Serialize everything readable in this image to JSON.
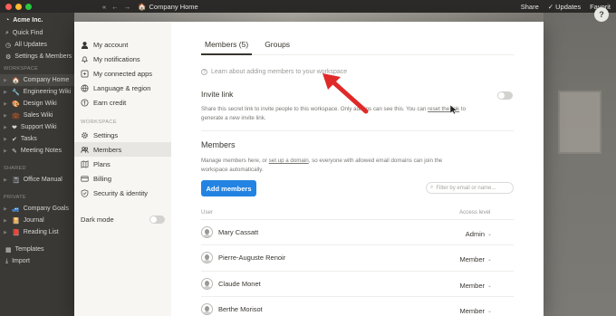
{
  "colors": {
    "accent": "#2383e2",
    "annotation": "#e02a2a"
  },
  "topbar": {
    "breadcrumb": "Company Home",
    "share": "Share",
    "updates": "Updates",
    "favorites": "Favorit",
    "help_label": "?"
  },
  "bg_sidebar": {
    "workspace": "Acme Inc.",
    "quick_find": "Quick Find",
    "all_updates": "All Updates",
    "settings_members": "Settings & Members",
    "section_workspace": "WORKSPACE",
    "pages": [
      "Company Home",
      "Engineering Wiki",
      "Design Wiki",
      "Sales Wiki",
      "Support Wiki",
      "Tasks",
      "Meeting Notes"
    ],
    "section_shared": "SHARED",
    "shared": [
      "Office Manual"
    ],
    "section_private": "PRIVATE",
    "private": [
      "Company Goals",
      "Journal",
      "Reading List"
    ],
    "templates": "Templates",
    "import": "Import"
  },
  "modal_sidebar": {
    "account": [
      "My account",
      "My notifications",
      "My connected apps",
      "Language & region",
      "Earn credit"
    ],
    "section_workspace": "WORKSPACE",
    "workspace": [
      "Settings",
      "Members",
      "Plans",
      "Billing",
      "Security & identity"
    ],
    "dark_mode": "Dark mode"
  },
  "modal": {
    "tab_members": "Members (5)",
    "tab_groups": "Groups",
    "learn_text": "Learn about adding members to your workspace",
    "invite_heading": "Invite link",
    "invite_desc_1": "Share this secret link to invite people to this workspace. Only admins can see this. You can",
    "invite_desc_reset": "reset the link",
    "invite_desc_2": "to generate a new invite link.",
    "members_heading": "Members",
    "members_desc_1": "Manage members here, or",
    "members_desc_link": "set up a domain",
    "members_desc_2": ", so everyone with allowed email domains can join the workspace automatically.",
    "add_members": "Add members",
    "filter_placeholder": "Filter by email or name...",
    "col_user": "User",
    "col_access": "Access level",
    "members": [
      {
        "name": "Mary Cassatt",
        "role": "Admin"
      },
      {
        "name": "Pierre-Auguste Renoir",
        "role": "Member"
      },
      {
        "name": "Claude Monet",
        "role": "Member"
      },
      {
        "name": "Berthe Morisot",
        "role": "Member"
      }
    ]
  }
}
